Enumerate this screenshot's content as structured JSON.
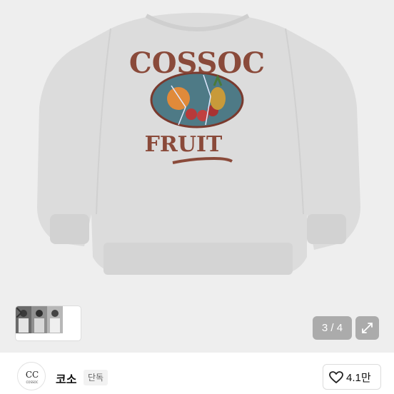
{
  "product_image": {
    "graphic_top_text": "COSSOC",
    "graphic_bottom_text": "FRUIT",
    "icon": "sweatshirt-image"
  },
  "gallery": {
    "counter": "3 / 4",
    "thumb_next_icon": "chevron-right-icon",
    "expand_icon": "expand-icon"
  },
  "store": {
    "name": "코소",
    "badge": "단독",
    "avatar_text": "CC",
    "avatar_subtext": "COSSOC"
  },
  "like": {
    "icon": "heart-outline-icon",
    "count": "4.1만"
  },
  "colors": {
    "sweatshirt": "#dcdcdc",
    "background": "#eeeeee",
    "print_brown": "#8a4a3a",
    "oval_blue": "#4e7a86"
  }
}
